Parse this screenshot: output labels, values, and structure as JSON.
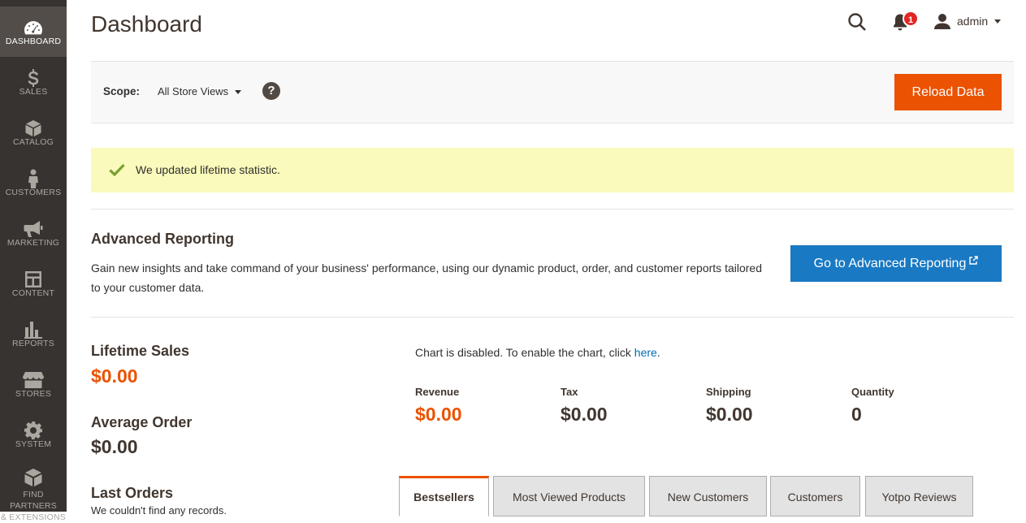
{
  "sidebar": {
    "items": [
      {
        "label": "DASHBOARD",
        "icon": "dashboard-icon"
      },
      {
        "label": "SALES",
        "icon": "dollar-icon"
      },
      {
        "label": "CATALOG",
        "icon": "box-icon"
      },
      {
        "label": "CUSTOMERS",
        "icon": "person-icon"
      },
      {
        "label": "MARKETING",
        "icon": "megaphone-icon"
      },
      {
        "label": "CONTENT",
        "icon": "layout-icon"
      },
      {
        "label": "REPORTS",
        "icon": "bar-chart-icon"
      },
      {
        "label": "STORES",
        "icon": "store-icon"
      },
      {
        "label": "SYSTEM",
        "icon": "gear-icon"
      },
      {
        "label": "FIND PARTNERS",
        "label2": "& EXTENSIONS",
        "icon": "partners-icon"
      }
    ]
  },
  "header": {
    "title": "Dashboard",
    "notification_count": "1",
    "user_name": "admin"
  },
  "scope": {
    "label": "Scope:",
    "value": "All Store Views",
    "help": "?",
    "reload_label": "Reload Data"
  },
  "message": {
    "text": "We updated lifetime statistic."
  },
  "advanced": {
    "title": "Advanced Reporting",
    "description": "Gain new insights and take command of your business' performance, using our dynamic product, order, and customer reports tailored to your customer data.",
    "button_label": "Go to Advanced Reporting"
  },
  "stats": {
    "lifetime_label": "Lifetime Sales",
    "lifetime_value": "$0.00",
    "average_label": "Average Order",
    "average_value": "$0.00",
    "last_orders_label": "Last Orders",
    "last_orders_note": "We couldn't find any records."
  },
  "chart": {
    "message": "Chart is disabled. To enable the chart, click ",
    "link": "here",
    "suffix": "."
  },
  "totals": [
    {
      "label": "Revenue",
      "value": "$0.00"
    },
    {
      "label": "Tax",
      "value": "$0.00"
    },
    {
      "label": "Shipping",
      "value": "$0.00"
    },
    {
      "label": "Quantity",
      "value": "0"
    }
  ],
  "tabs": [
    {
      "label": "Bestsellers",
      "active": true
    },
    {
      "label": "Most Viewed Products"
    },
    {
      "label": "New Customers"
    },
    {
      "label": "Customers"
    },
    {
      "label": "Yotpo Reviews"
    }
  ],
  "colors": {
    "accent": "#eb5202",
    "primary_blue": "#1979c3",
    "sidebar_bg": "#373330",
    "message_bg": "#fafabc"
  }
}
